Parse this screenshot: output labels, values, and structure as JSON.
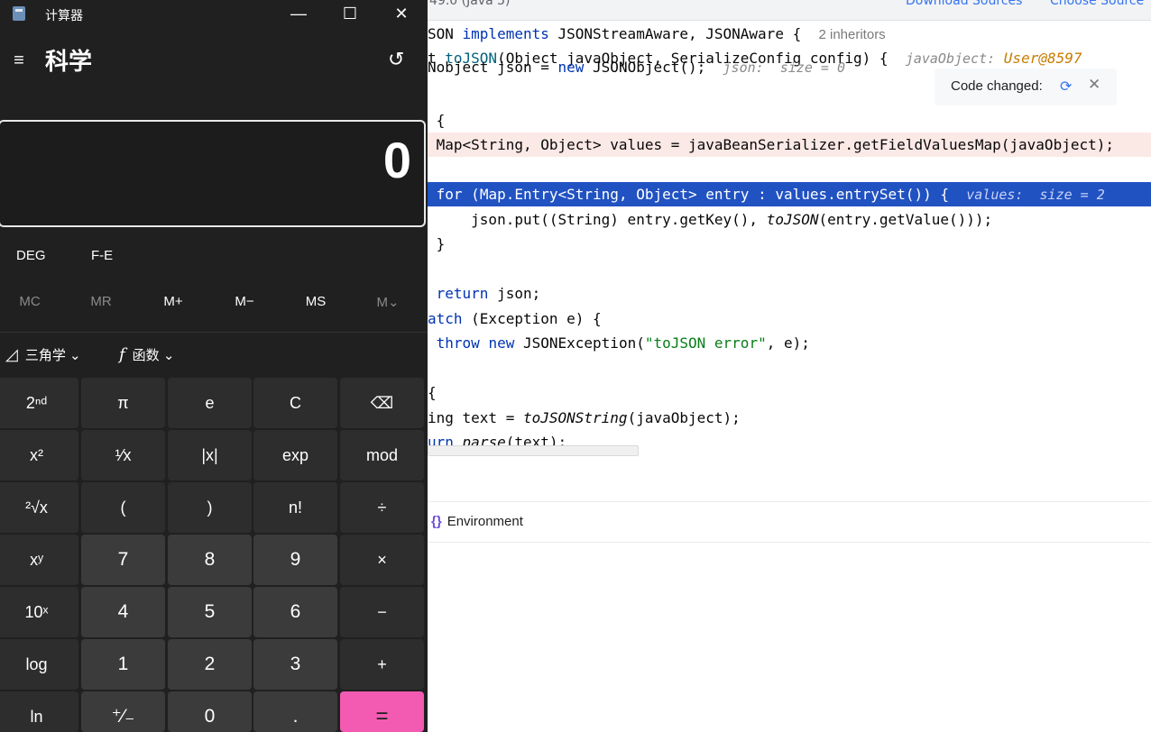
{
  "ide": {
    "topbar": {
      "version": "49.0 (Java 5)",
      "download_sources": "Download Sources",
      "choose_sources": "Choose Source"
    },
    "code_lines": [
      {
        "code": "SON implements JSONStreamAware, JSONAware {",
        "inheritors": "2 inheritors"
      },
      {
        "code": "t toJSON(Object javaObject, SerializeConfig config) {",
        "hint_label": "javaObject:",
        "hint_value": "User@8597"
      },
      {
        "code": "Nobject json = new JSONObject();",
        "hint": "json:  size = 0"
      },
      {
        "code": " {"
      },
      {
        "code": " Map<String, Object> values = javaBeanSerializer.getFieldValuesMap(javaObject);"
      },
      {
        "code": " for (Map.Entry<String, Object> entry : values.entrySet()) {",
        "hint": "values:  size = 2"
      },
      {
        "code": "     json.put((String) entry.getKey(), toJSON(entry.getValue()));"
      },
      {
        "code": " }"
      },
      {
        "code": " return json;"
      },
      {
        "code": "atch (Exception e) {"
      },
      {
        "code": " throw new JSONException(\"toJSON error\", e);"
      },
      {
        "code": "{"
      },
      {
        "code": "ing text = toJSONString(javaObject);"
      },
      {
        "code": "urn parse(text);"
      }
    ],
    "toast": {
      "text": "Code changed:",
      "close": "✕"
    },
    "bottom_tab": {
      "icon": "{}",
      "label": "Environment"
    }
  },
  "calculator": {
    "title": "计算器",
    "window_controls": {
      "minimize": "—",
      "maximize": "☐",
      "close": "✕"
    },
    "menu_icon": "≡",
    "mode": "科学",
    "history_icon": "↺",
    "display_value": "0",
    "angle_unit": "DEG",
    "fe": "F-E",
    "memory": [
      "MC",
      "MR",
      "M+",
      "M−",
      "MS",
      "M⌄"
    ],
    "trig": {
      "icon": "◿",
      "label": "三角学",
      "chevron": "⌄"
    },
    "func": {
      "icon": "f",
      "label": "函数",
      "chevron": "⌄"
    },
    "keys": [
      [
        "2ⁿᵈ",
        "π",
        "e",
        "C",
        "⌫"
      ],
      [
        "x²",
        "¹⁄x",
        "|x|",
        "exp",
        "mod"
      ],
      [
        "²√x",
        "(",
        ")",
        "n!",
        "÷"
      ],
      [
        "xʸ",
        "7",
        "8",
        "9",
        "×"
      ],
      [
        "10ˣ",
        "4",
        "5",
        "6",
        "−"
      ],
      [
        "log",
        "1",
        "2",
        "3",
        "+"
      ],
      [
        "ln",
        "⁺⁄₋",
        "0",
        ".",
        "="
      ]
    ]
  }
}
